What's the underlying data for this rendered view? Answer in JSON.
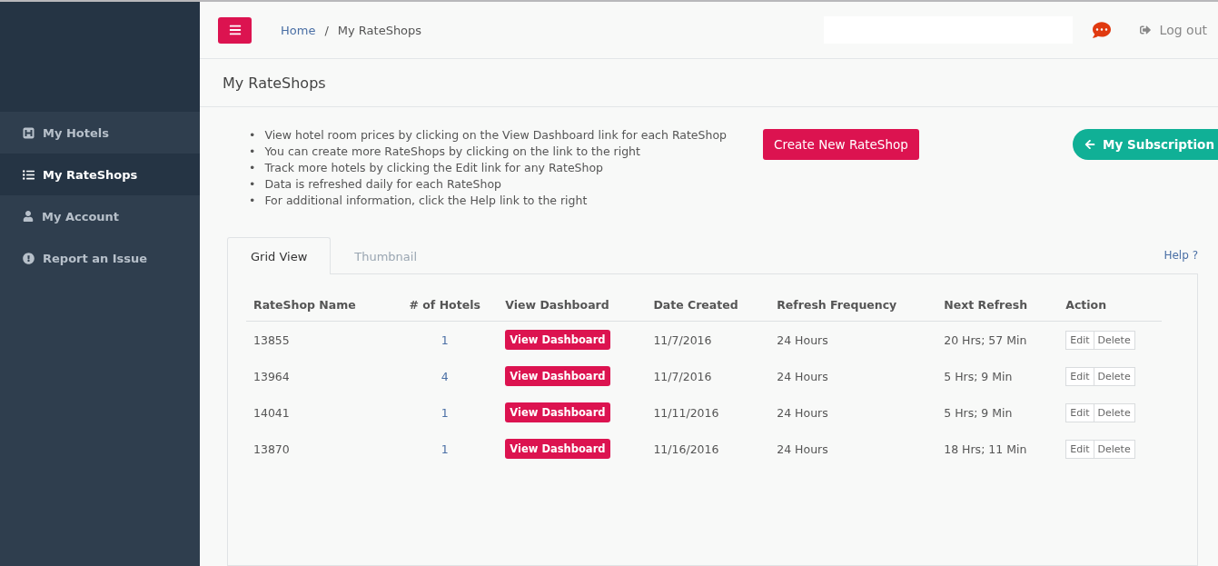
{
  "sidebar": {
    "items": [
      {
        "label": "My Hotels",
        "selected": false
      },
      {
        "label": "My RateShops",
        "selected": true
      },
      {
        "label": "My Account",
        "selected": false
      },
      {
        "label": "Report an Issue",
        "selected": false
      }
    ]
  },
  "header": {
    "breadcrumb": [
      "Home",
      "My RateShops"
    ],
    "separator": "/",
    "logout": "Log out"
  },
  "page_title": "My RateShops",
  "tips": [
    {
      "marker": "•",
      "text": "View hotel room prices by clicking on the View Dashboard link for each RateShop"
    },
    {
      "marker": "•",
      "text": "You can create more RateShops by clicking on the link to the right"
    },
    {
      "marker": "•",
      "text": "Track more hotels by clicking the Edit link for any RateShop"
    },
    {
      "marker": "•",
      "text": "Data is refreshed daily for each RateShop"
    },
    {
      "marker": "•",
      "text": "For additional information, click the Help link to the right"
    }
  ],
  "create_button": "Create New RateShop",
  "subscription_button": "My Subscription",
  "tabs": [
    {
      "label": "Grid View",
      "selected": true
    },
    {
      "label": "Thumbnail",
      "selected": false
    }
  ],
  "help_link": "Help ?",
  "table": {
    "columns": [
      "RateShop Name",
      "# of Hotels",
      "View Dashboard",
      "Date Created",
      "Refresh Frequency",
      "Next Refresh",
      "Action"
    ],
    "rows": [
      {
        "name": "13855",
        "hotels": "1",
        "dashboard": "View Dashboard",
        "created": "11/7/2016",
        "frequency": "24 Hours",
        "next": "20 Hrs; 57 Min",
        "actions": [
          "Edit",
          "Delete"
        ]
      },
      {
        "name": "13964",
        "hotels": "4",
        "dashboard": "View Dashboard",
        "created": "11/7/2016",
        "frequency": "24 Hours",
        "next": "5 Hrs; 9 Min",
        "actions": [
          "Edit",
          "Delete"
        ]
      },
      {
        "name": "14041",
        "hotels": "1",
        "dashboard": "View Dashboard",
        "created": "11/11/2016",
        "frequency": "24 Hours",
        "next": "5 Hrs; 9 Min",
        "actions": [
          "Edit",
          "Delete"
        ]
      },
      {
        "name": "13870",
        "hotels": "1",
        "dashboard": "View Dashboard",
        "created": "11/16/2016",
        "frequency": "24 Hours",
        "next": "18 Hrs; 11 Min",
        "actions": [
          "Edit",
          "Delete"
        ]
      }
    ]
  }
}
